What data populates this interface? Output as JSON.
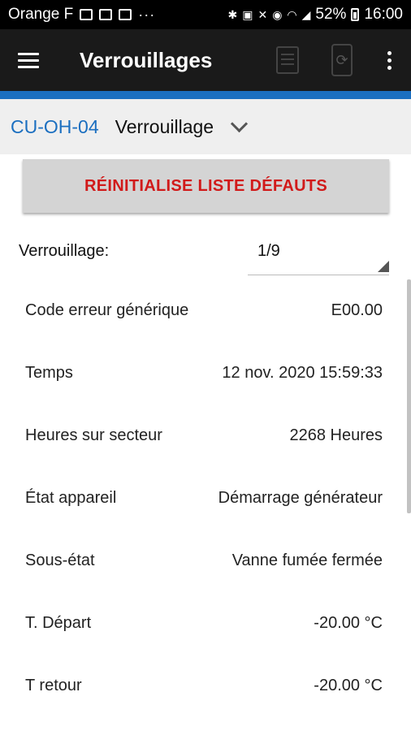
{
  "status_bar": {
    "carrier": "Orange F",
    "overflow": "···",
    "battery": "52%",
    "time": "16:00"
  },
  "app_bar": {
    "title": "Verrouillages"
  },
  "sub_header": {
    "device_code": "CU-OH-04",
    "view": "Verrouillage"
  },
  "reset_button": {
    "label": "RÉINITIALISE LISTE DÉFAUTS"
  },
  "lockout": {
    "label": "Verrouillage:",
    "value": "1/9"
  },
  "details": [
    {
      "label": "Code erreur générique",
      "value": "E00.00"
    },
    {
      "label": "Temps",
      "value": "12 nov. 2020 15:59:33"
    },
    {
      "label": "Heures sur secteur",
      "value": "2268 Heures"
    },
    {
      "label": "État appareil",
      "value": "Démarrage générateur"
    },
    {
      "label": "Sous-état",
      "value": "Vanne fumée fermée"
    },
    {
      "label": "T. Départ",
      "value": "-20.00 °C"
    },
    {
      "label": "T retour",
      "value": "-20.00 °C"
    }
  ],
  "colors": {
    "accent": "#1b6fc0",
    "reset_text": "#d11a1a",
    "app_bar": "#1a1a1a"
  },
  "icons": [
    "menu-icon",
    "document-icon",
    "phone-refresh-icon",
    "more-vert-icon",
    "chevron-down-icon",
    "dropdown-triangle-icon"
  ]
}
